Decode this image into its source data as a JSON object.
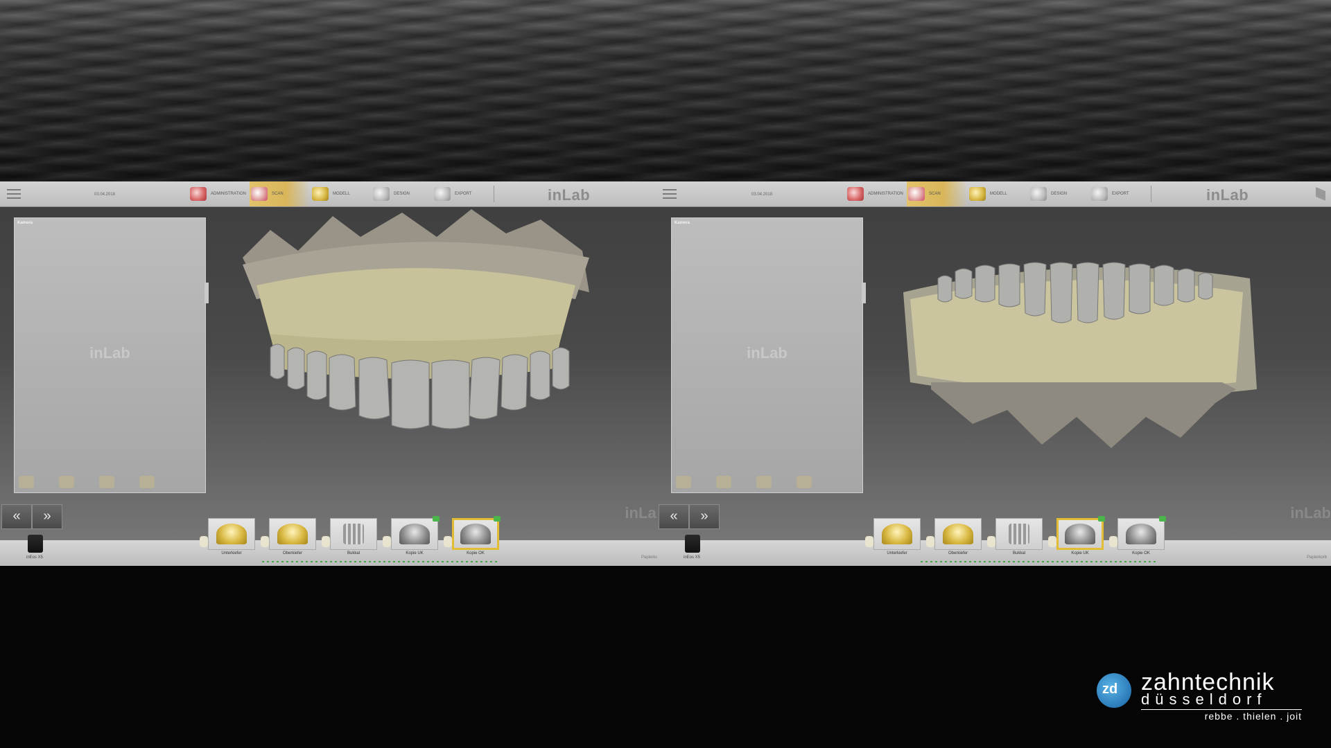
{
  "app": {
    "brand": "inLab",
    "date": "03.04.2018"
  },
  "toolbar": {
    "steps": [
      "ADMINISTRATION",
      "SCAN",
      "MODELL",
      "DESIGN",
      "EXPORT"
    ],
    "active_step": "SCAN"
  },
  "camera": {
    "title": "Kamera",
    "placeholder_logo": "inLab"
  },
  "nav": {
    "prev_label": "«",
    "next_label": "»"
  },
  "device": {
    "name": "inEos X5"
  },
  "panels": [
    {
      "watermark": "inLab",
      "right_label": "Papierkorb",
      "catalog": [
        {
          "label": "Unterkiefer",
          "type": "gold",
          "selected": false,
          "checked": false
        },
        {
          "label": "Oberkiefer",
          "type": "gold",
          "selected": false,
          "checked": false
        },
        {
          "label": "Bukkal",
          "type": "bukkal",
          "selected": false,
          "checked": false
        },
        {
          "label": "Kopie UK",
          "type": "grey",
          "selected": false,
          "checked": true
        },
        {
          "label": "Kopie OK",
          "type": "grey",
          "selected": true,
          "checked": true
        }
      ]
    },
    {
      "watermark": "inLab",
      "right_label": "Papierkorb",
      "catalog": [
        {
          "label": "Unterkiefer",
          "type": "gold",
          "selected": false,
          "checked": false
        },
        {
          "label": "Oberkiefer",
          "type": "gold",
          "selected": false,
          "checked": false
        },
        {
          "label": "Bukkal",
          "type": "bukkal",
          "selected": false,
          "checked": false
        },
        {
          "label": "Kopie UK",
          "type": "grey",
          "selected": true,
          "checked": true
        },
        {
          "label": "Kopie OK",
          "type": "grey",
          "selected": false,
          "checked": true
        }
      ]
    }
  ],
  "logo": {
    "name": "zahntechnik",
    "city": "düsseldorf",
    "people": "rebbe . thielen . joit",
    "mark": "zd"
  }
}
